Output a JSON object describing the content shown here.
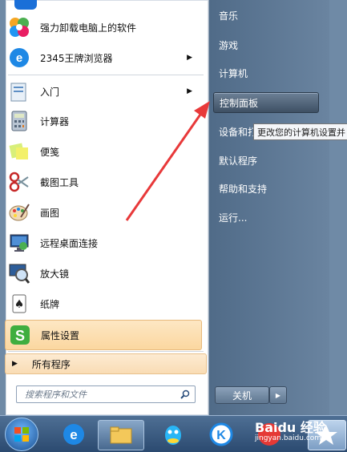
{
  "left_items": [
    {
      "label": "强力卸载电脑上的软件",
      "icon": "pinwheel-icon",
      "arrow": false
    },
    {
      "label": "2345王牌浏览器",
      "icon": "browser-e-icon",
      "arrow": true
    },
    {
      "label": "入门",
      "icon": "getting-started-icon",
      "arrow": true
    },
    {
      "label": "计算器",
      "icon": "calculator-icon",
      "arrow": false
    },
    {
      "label": "便笺",
      "icon": "sticky-notes-icon",
      "arrow": false
    },
    {
      "label": "截图工具",
      "icon": "scissors-icon",
      "arrow": false
    },
    {
      "label": "画图",
      "icon": "paint-palette-icon",
      "arrow": false
    },
    {
      "label": "远程桌面连接",
      "icon": "remote-desktop-icon",
      "arrow": false
    },
    {
      "label": "放大镜",
      "icon": "magnifier-icon",
      "arrow": false
    },
    {
      "label": "纸牌",
      "icon": "cards-icon",
      "arrow": false
    },
    {
      "label": "属性设置",
      "icon": "sogou-s-icon",
      "arrow": false
    }
  ],
  "all_programs": "所有程序",
  "search_placeholder": "搜索程序和文件",
  "right_items": [
    {
      "label": "音乐"
    },
    {
      "label": "游戏"
    },
    {
      "label": "计算机"
    },
    {
      "label": "控制面板"
    },
    {
      "label": "设备和打"
    },
    {
      "label": "默认程序"
    },
    {
      "label": "帮助和支持"
    },
    {
      "label": "运行..."
    }
  ],
  "tooltip": "更改您的计算机设置并",
  "shutdown_label": "关机",
  "watermark": "Baidu 经验",
  "watermark_sub": "jingyan.baidu.com",
  "colors": {
    "arrow": "#e8393a",
    "highlight": "#fbd7a0",
    "right_panel": "#5a7591"
  }
}
